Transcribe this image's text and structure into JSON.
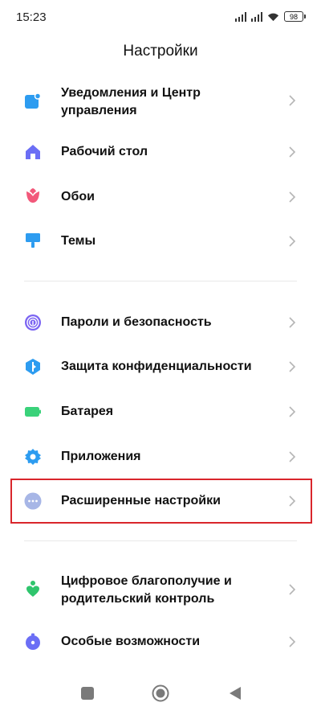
{
  "status_bar": {
    "time": "15:23",
    "battery": "98"
  },
  "header": {
    "title": "Настройки"
  },
  "items": [
    {
      "label": "Уведомления и Центр\nуправления",
      "icon": "notification-icon",
      "color": "#2d9cf0"
    },
    {
      "label": "Рабочий стол",
      "icon": "home-icon",
      "color": "#6b6ef5"
    },
    {
      "label": "Обои",
      "icon": "tulip-icon",
      "color": "#f2587a"
    },
    {
      "label": "Темы",
      "icon": "theme-brush-icon",
      "color": "#2d9cf0"
    },
    {
      "label": "Пароли и безопасность",
      "icon": "fingerprint-icon",
      "color": "#7a63f2"
    },
    {
      "label": "Защита конфиденциальности",
      "icon": "privacy-shield-icon",
      "color": "#2d9cf0"
    },
    {
      "label": "Батарея",
      "icon": "battery-icon",
      "color": "#3ad27a"
    },
    {
      "label": "Приложения",
      "icon": "gear-icon",
      "color": "#2d9cf0"
    },
    {
      "label": "Расширенные настройки",
      "icon": "more-dots-icon",
      "color": "#a7b6e6"
    },
    {
      "label": "Цифровое благополучие и\nродительский контроль",
      "icon": "wellbeing-icon",
      "color": "#2fc56d"
    },
    {
      "label": "Особые возможности",
      "icon": "accessibility-icon",
      "color": "#6b6ef5"
    }
  ],
  "highlight_color": "#d9262c"
}
